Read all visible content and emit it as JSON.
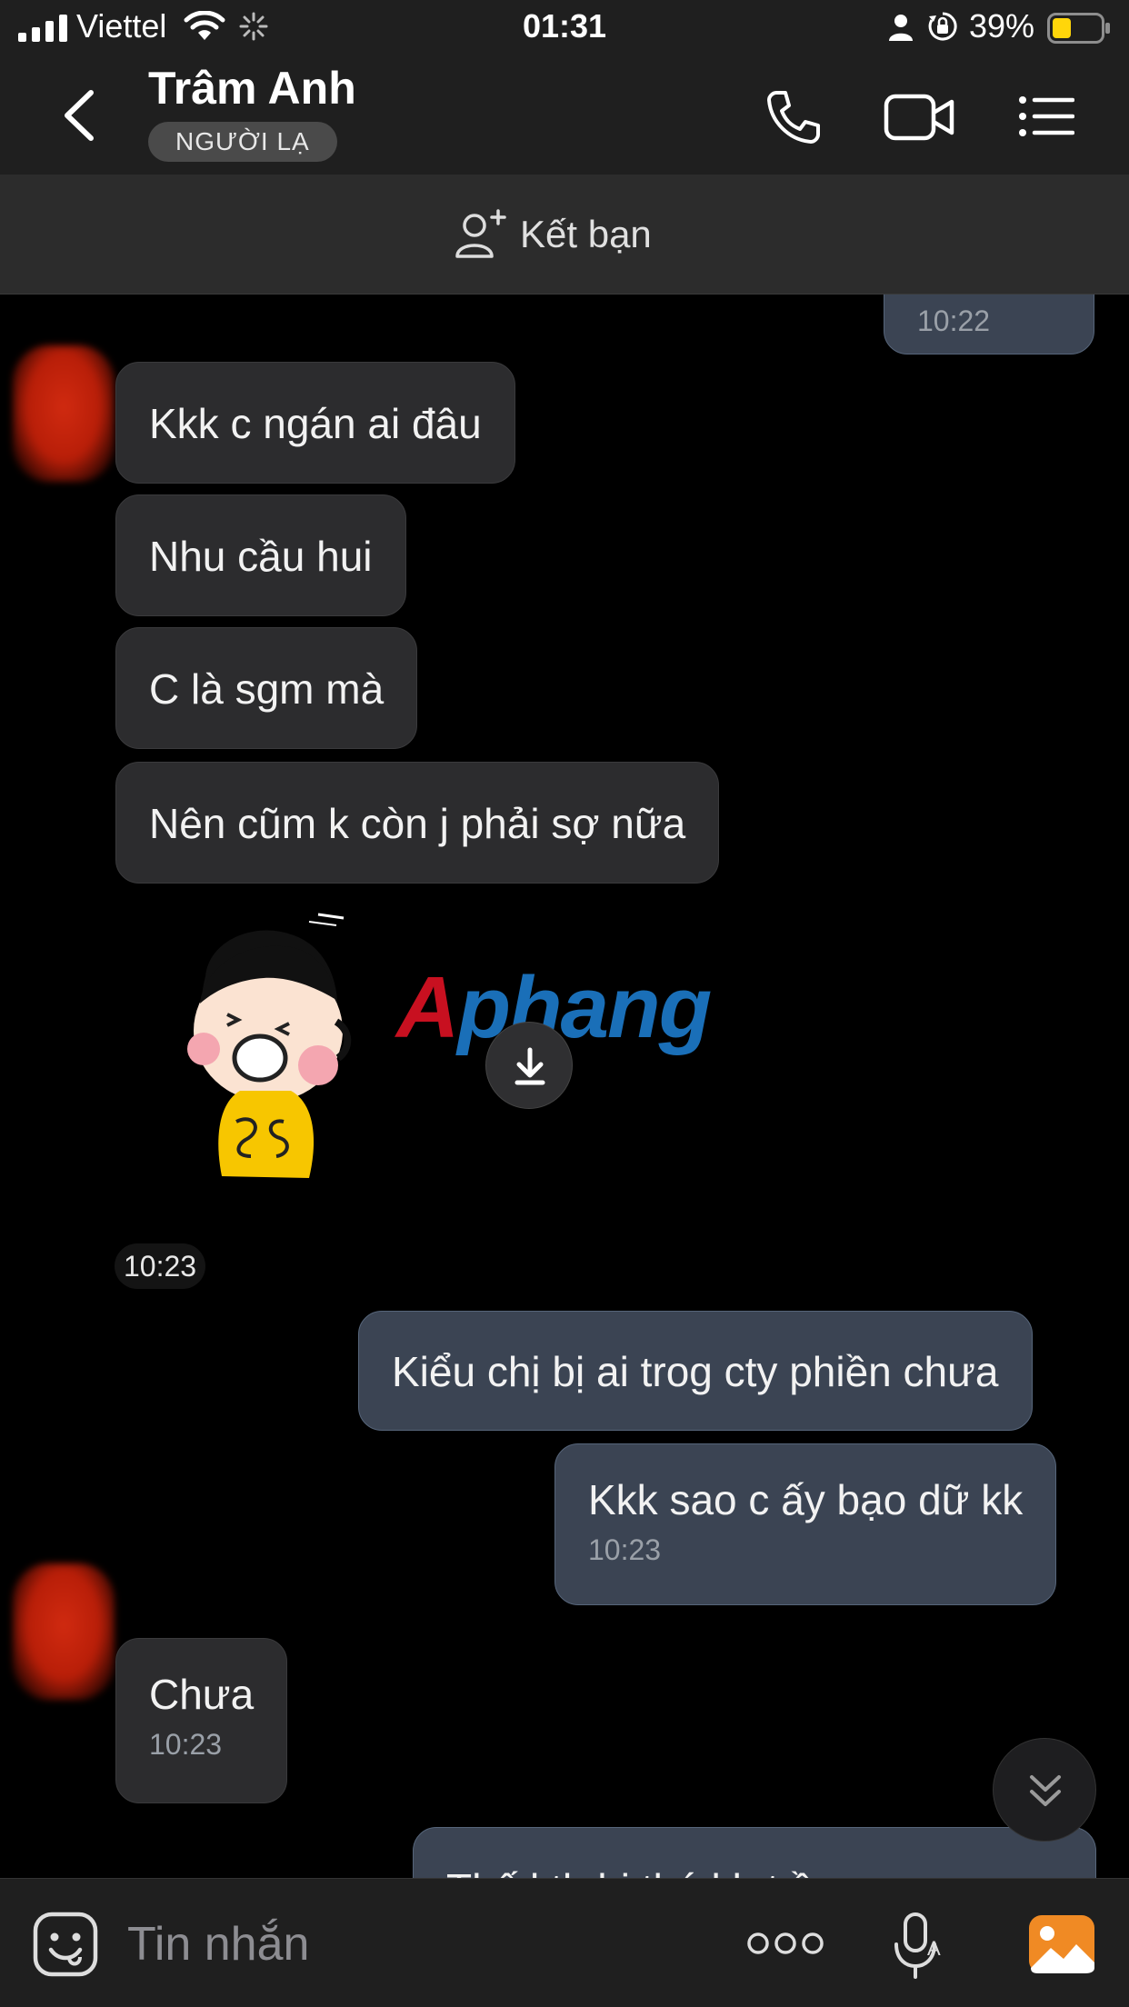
{
  "status_bar": {
    "carrier": "Viettel",
    "time": "01:31",
    "battery": "39%",
    "icons": [
      "signal-icon",
      "wifi-icon",
      "loading-icon",
      "person-icon",
      "rotation-lock-icon",
      "battery-icon"
    ]
  },
  "header": {
    "contact_name": "Trâm Anh",
    "badge": "NGƯỜI LẠ",
    "icons": [
      "back-icon",
      "phone-icon",
      "video-call-icon",
      "menu-icon"
    ]
  },
  "add_friend": {
    "label": "Kết bạn",
    "icon": "add-person-icon"
  },
  "messages": [
    {
      "direction": "out",
      "text": "",
      "time": "10:22",
      "partial": true
    },
    {
      "direction": "in",
      "text": "Kkk c ngán ai đâu"
    },
    {
      "direction": "in",
      "text": "Nhu cầu hui"
    },
    {
      "direction": "in",
      "text": "C là sgm mà"
    },
    {
      "direction": "in",
      "text": "Nên cũm k còn j phải sợ nữa"
    },
    {
      "direction": "in",
      "type": "sticker",
      "time": "10:23",
      "watermark": "Aphang"
    },
    {
      "direction": "out",
      "text": "Kiểu chị bị ai trog cty phiền chưa"
    },
    {
      "direction": "out",
      "text": "Kkk sao c ấy bạo dữ kk",
      "time": "10:23"
    },
    {
      "direction": "in",
      "text": "Chưa",
      "time": "10:23"
    },
    {
      "direction": "out",
      "text": "Thấ l th    hi thá  l     h      t  ề",
      "partial": true
    }
  ],
  "input_bar": {
    "placeholder": "Tin nhắn",
    "icons": [
      "emoji-icon",
      "more-icon",
      "voice-to-text-icon",
      "image-icon"
    ]
  },
  "colors": {
    "background": "#000000",
    "bar": "#1f1f1f",
    "incoming_bubble": "#2c2c2e",
    "outgoing_bubble": "#3b4453",
    "outgoing_border": "#56657a",
    "accent_orange": "#f08a24"
  }
}
